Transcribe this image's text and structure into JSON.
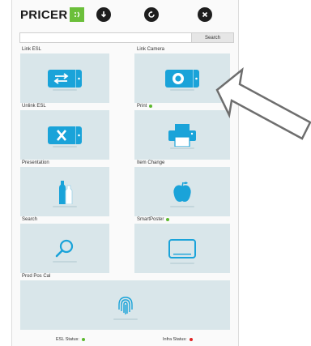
{
  "header": {
    "logo_text": "PRICER",
    "logo_icon": "smile-icon",
    "brand_color": "#6bbf3a",
    "buttons": [
      {
        "icon": "download-icon"
      },
      {
        "icon": "refresh-icon"
      },
      {
        "icon": "close-icon"
      }
    ]
  },
  "search": {
    "value": "",
    "placeholder": "",
    "button_label": "Search"
  },
  "tiles": [
    {
      "label": "Link ESL",
      "icon": "link-esl-icon",
      "status_dot": null
    },
    {
      "label": "Link Camera",
      "icon": "camera-icon",
      "status_dot": null
    },
    {
      "label": "Unlink ESL",
      "icon": "unlink-esl-icon",
      "status_dot": null
    },
    {
      "label": "Print",
      "icon": "printer-icon",
      "status_dot": "#5cb82e"
    },
    {
      "label": "Presentation",
      "icon": "bottles-icon",
      "status_dot": null
    },
    {
      "label": "Item Change",
      "icon": "apple-icon",
      "status_dot": null
    },
    {
      "label": "Search",
      "icon": "magnifier-icon",
      "status_dot": null
    },
    {
      "label": "SmartPoster",
      "icon": "screen-icon",
      "status_dot": "#5cb82e"
    },
    {
      "label": "Prod Pos Cal",
      "icon": "fingerprint-icon",
      "status_dot": null
    }
  ],
  "footer": {
    "esl_status_label": "ESL Status:",
    "esl_status_color": "#5cb82e",
    "infra_status_label": "Infra Status:",
    "infra_status_color": "#e02424"
  },
  "colors": {
    "tile_bg": "#d9e6ea",
    "icon_blue": "#1aa3d9",
    "arrow_outline": "#6e6e6e"
  }
}
